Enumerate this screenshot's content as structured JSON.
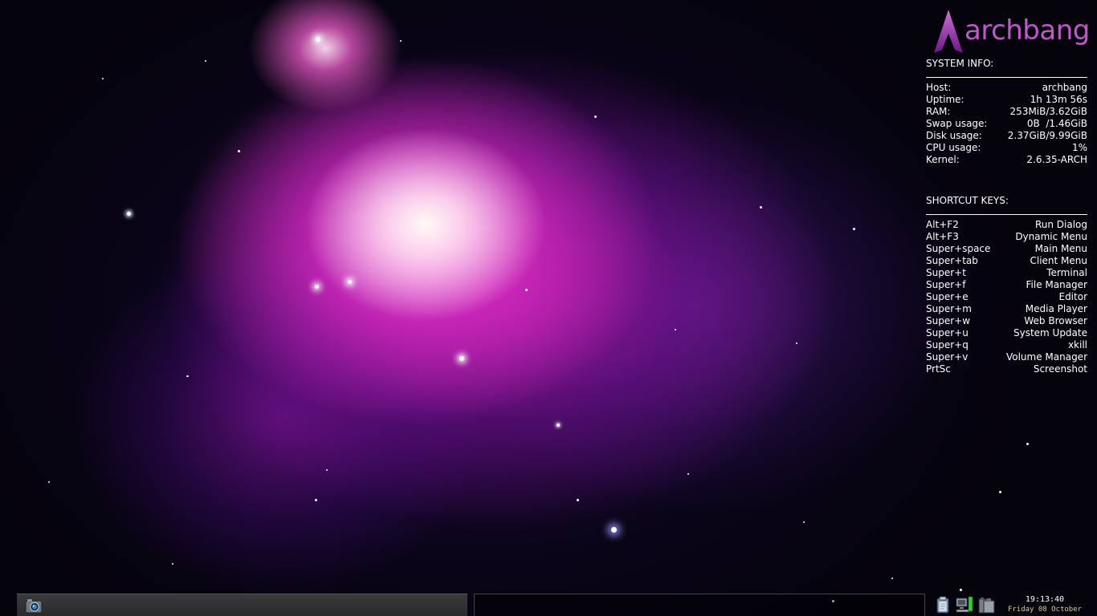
{
  "conky": {
    "logo_text": "archbang",
    "system_title": "SYSTEM INFO:",
    "system": [
      {
        "label": "Host:",
        "value": "archbang"
      },
      {
        "label": "Uptime:",
        "value": "1h 13m 56s"
      },
      {
        "label": "RAM:",
        "value": "253MiB/3.62GiB"
      },
      {
        "label": "Swap usage:",
        "value": "0B  /1.46GiB"
      },
      {
        "label": "Disk usage:",
        "value": "2.37GiB/9.99GiB"
      },
      {
        "label": "CPU usage:",
        "value": "1%"
      },
      {
        "label": "Kernel:",
        "value": "2.6.35-ARCH"
      }
    ],
    "shortcuts_title": "SHORTCUT KEYS:",
    "shortcuts": [
      {
        "key": "Alt+F2",
        "action": "Run Dialog"
      },
      {
        "key": "Alt+F3",
        "action": "Dynamic Menu"
      },
      {
        "key": "Super+space",
        "action": "Main Menu"
      },
      {
        "key": "Super+tab",
        "action": "Client Menu"
      },
      {
        "key": "Super+t",
        "action": "Terminal"
      },
      {
        "key": "Super+f",
        "action": "File Manager"
      },
      {
        "key": "Super+e",
        "action": "Editor"
      },
      {
        "key": "Super+m",
        "action": "Media Player"
      },
      {
        "key": "Super+w",
        "action": "Web Browser"
      },
      {
        "key": "Super+u",
        "action": "System Update"
      },
      {
        "key": "Super+q",
        "action": "xkill"
      },
      {
        "key": "Super+v",
        "action": "Volume Manager"
      },
      {
        "key": "PrtSc",
        "action": "Screenshot"
      }
    ]
  },
  "taskbar": {
    "launcher_icon": "camera-icon",
    "tray_icons": [
      "clipboard-icon",
      "network-icon",
      "battery-icon"
    ],
    "clock_time": "19:13:40",
    "clock_date": "Friday 08 October"
  },
  "colors": {
    "logo": "#c058c8",
    "clock_date": "#d8d080",
    "network_active": "#3ccc3c"
  }
}
